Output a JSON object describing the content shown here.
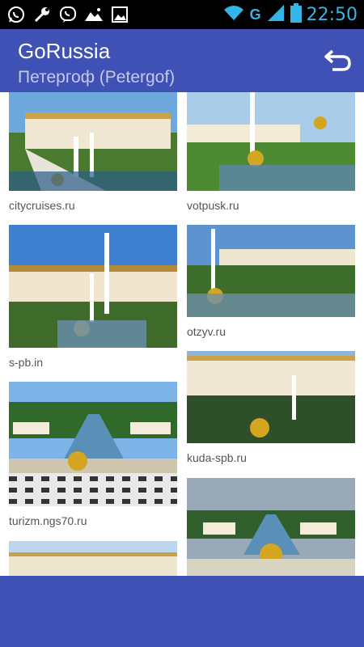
{
  "status_bar": {
    "time": "22:50",
    "network": "G",
    "icons": [
      "whatsapp-icon",
      "wrench-icon",
      "viber-icon",
      "photo-icon",
      "gallery-icon",
      "wifi-icon",
      "signal-icon",
      "battery-icon"
    ]
  },
  "action_bar": {
    "title": "GoRussia",
    "subtitle": "Петергоф (Petergof)",
    "back_icon": "back-icon",
    "color": "#3f51b5"
  },
  "grid": {
    "left": [
      {
        "caption": "citycruises.ru"
      },
      {
        "caption": "s-pb.in"
      },
      {
        "caption": "turizm.ngs70.ru"
      },
      {
        "caption": ""
      }
    ],
    "right": [
      {
        "caption": "votpusk.ru"
      },
      {
        "caption": "otzyv.ru"
      },
      {
        "caption": "kuda-spb.ru"
      },
      {
        "caption": ""
      }
    ]
  }
}
